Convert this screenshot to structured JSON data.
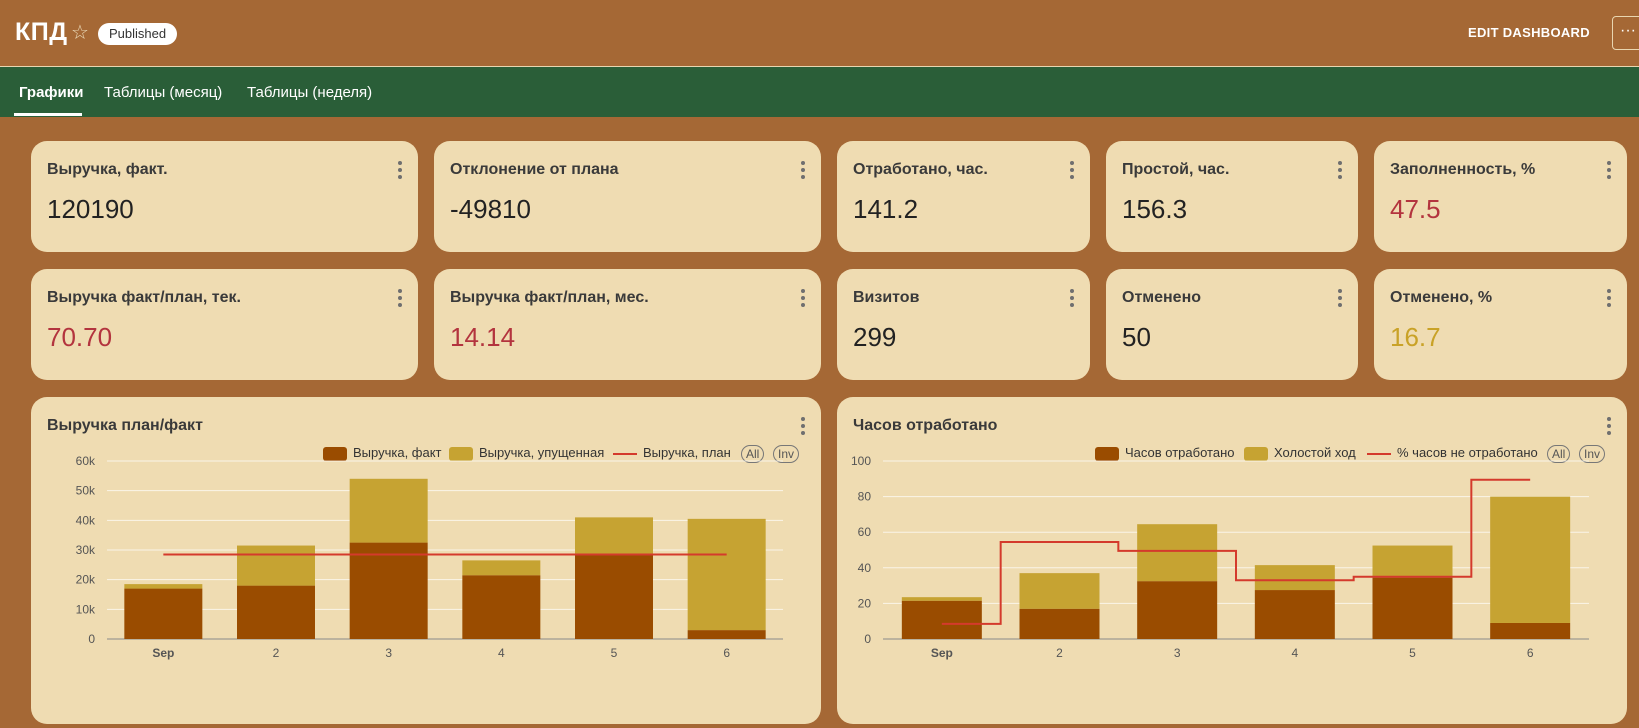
{
  "header": {
    "title": "КПД",
    "status_badge": "Published",
    "edit_label": "EDIT DASHBOARD",
    "more_label": "···"
  },
  "tabs": [
    "Графики",
    "Таблицы (месяц)",
    "Таблицы (неделя)"
  ],
  "kpi_row1": [
    {
      "title": "Выручка, факт.",
      "value": "120190",
      "color": "#222222"
    },
    {
      "title": "Отклонение от плана",
      "value": "-49810",
      "color": "#222222"
    },
    {
      "title": "Отработано, час.",
      "value": "141.2",
      "color": "#222222"
    },
    {
      "title": "Простой, час.",
      "value": "156.3",
      "color": "#222222"
    },
    {
      "title": "Заполненность, %",
      "value": "47.5",
      "color": "#b3343e"
    }
  ],
  "kpi_row2": [
    {
      "title": "Выручка факт/план, тек.",
      "value": "70.70",
      "color": "#b3343e"
    },
    {
      "title": "Выручка факт/план, мес.",
      "value": "14.14",
      "color": "#b3343e"
    },
    {
      "title": "Визитов",
      "value": "299",
      "color": "#222222"
    },
    {
      "title": "Отменено",
      "value": "50",
      "color": "#222222"
    },
    {
      "title": "Отменено, %",
      "value": "16.7",
      "color": "#c9a227"
    }
  ],
  "colors": {
    "fact": "#9a4c00",
    "extra": "#c6a332",
    "line": "#d43a2c",
    "card_bg": "#efdcb2",
    "page_bg": "#a56835",
    "tabbar_bg": "#2a5e38"
  },
  "chart_legend_controls": {
    "all": "All",
    "inv": "Inv"
  },
  "chart_data": [
    {
      "type": "bar",
      "title": "Выручка план/факт",
      "categories": [
        "Sep",
        "2",
        "3",
        "4",
        "5",
        "6"
      ],
      "stacked": true,
      "ylim": [
        0,
        60000
      ],
      "yticks": [
        "0",
        "10k",
        "20k",
        "30k",
        "40k",
        "50k",
        "60k"
      ],
      "series": [
        {
          "name": "Выручка, факт",
          "kind": "bar",
          "values": [
            17000,
            18000,
            32500,
            21500,
            28500,
            3000
          ]
        },
        {
          "name": "Выручка, упущенная",
          "kind": "bar",
          "values": [
            1500,
            13500,
            21500,
            5000,
            12500,
            37500
          ]
        },
        {
          "name": "Выручка, план",
          "kind": "line",
          "values": [
            28500,
            28500,
            28500,
            28500,
            28500,
            28500
          ]
        }
      ],
      "grid": true,
      "legend": "top-right"
    },
    {
      "type": "bar",
      "title": "Часов отработано",
      "categories": [
        "Sep",
        "2",
        "3",
        "4",
        "5",
        "6"
      ],
      "stacked": true,
      "ylim": [
        0,
        100
      ],
      "yticks": [
        "0",
        "20",
        "40",
        "60",
        "80",
        "100"
      ],
      "series": [
        {
          "name": "Часов отработано",
          "kind": "bar",
          "values": [
            21.5,
            17,
            32.5,
            27.5,
            34.5,
            9
          ]
        },
        {
          "name": "Холостой ход",
          "kind": "bar",
          "values": [
            2,
            20,
            32,
            14,
            18,
            71
          ]
        },
        {
          "name": "% часов не отработано",
          "kind": "step-line",
          "values": [
            8.5,
            54.5,
            49.5,
            33,
            35,
            89.5
          ]
        }
      ],
      "grid": true,
      "legend": "top-right"
    }
  ]
}
